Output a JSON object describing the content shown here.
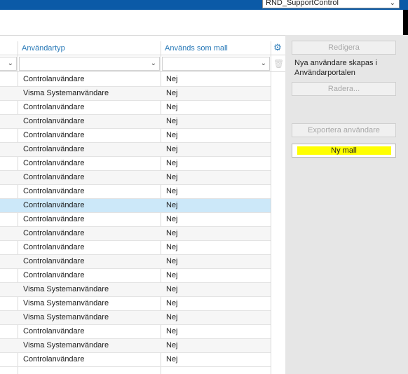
{
  "header": {
    "company": "RND_SupportControl"
  },
  "grid": {
    "columns": [
      "Användartyp",
      "Används som mall"
    ],
    "rows": [
      {
        "type": "Controlanvändare",
        "template": "Nej"
      },
      {
        "type": "Visma Systemanvändare",
        "template": "Nej"
      },
      {
        "type": "Controlanvändare",
        "template": "Nej"
      },
      {
        "type": "Controlanvändare",
        "template": "Nej"
      },
      {
        "type": "Controlanvändare",
        "template": "Nej"
      },
      {
        "type": "Controlanvändare",
        "template": "Nej"
      },
      {
        "type": "Controlanvändare",
        "template": "Nej"
      },
      {
        "type": "Controlanvändare",
        "template": "Nej"
      },
      {
        "type": "Controlanvändare",
        "template": "Nej"
      },
      {
        "type": "Controlanvändare",
        "template": "Nej"
      },
      {
        "type": "Controlanvändare",
        "template": "Nej"
      },
      {
        "type": "Controlanvändare",
        "template": "Nej"
      },
      {
        "type": "Controlanvändare",
        "template": "Nej"
      },
      {
        "type": "Controlanvändare",
        "template": "Nej"
      },
      {
        "type": "Controlanvändare",
        "template": "Nej"
      },
      {
        "type": "Visma Systemanvändare",
        "template": "Nej"
      },
      {
        "type": "Visma Systemanvändare",
        "template": "Nej"
      },
      {
        "type": "Visma Systemanvändare",
        "template": "Nej"
      },
      {
        "type": "Controlanvändare",
        "template": "Nej"
      },
      {
        "type": "Visma Systemanvändare",
        "template": "Nej"
      },
      {
        "type": "Controlanvändare",
        "template": "Nej"
      }
    ],
    "selected_row_index": 9
  },
  "side": {
    "edit_label": "Redigera",
    "note": "Nya användare skapas i Användarportalen",
    "delete_label": "Radera...",
    "export_label": "Exportera användare",
    "new_template_label": "Ny mall"
  },
  "icons": {
    "settings": "gear-icon",
    "delete_filter": "trash-icon",
    "dropdown": "chevron-down-icon"
  },
  "colors": {
    "accent": "#2a7ab8",
    "topbar": "#0b5aa7",
    "selected_row": "#cce8f9",
    "highlight": "#ffff00"
  }
}
